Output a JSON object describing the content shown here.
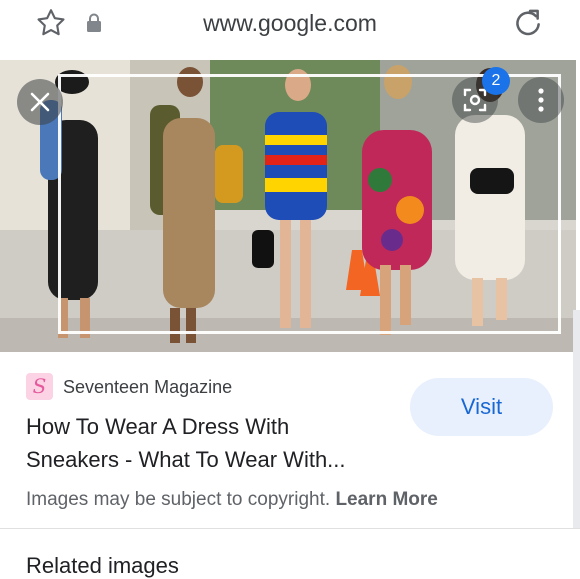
{
  "urlbar": {
    "url": "www.google.com",
    "star_icon": "star-outline-icon",
    "lock_icon": "lock-icon",
    "reload_icon": "reload-icon"
  },
  "viewer": {
    "close_icon": "close-icon",
    "lens_icon": "google-lens-icon",
    "lens_badge": "2",
    "more_icon": "more-vertical-icon"
  },
  "result": {
    "source_logo": "S",
    "source_name": "Seventeen Magazine",
    "title": "How To Wear A Dress With Sneakers - What To Wear With...",
    "visit_label": "Visit",
    "copyright_text": "Images may be subject to copyright.",
    "learn_more": "Learn More"
  },
  "related": {
    "heading": "Related images"
  },
  "colors": {
    "accent": "#1a73e8",
    "visit_bg": "#e8f0fe",
    "visit_text": "#1967d2"
  }
}
